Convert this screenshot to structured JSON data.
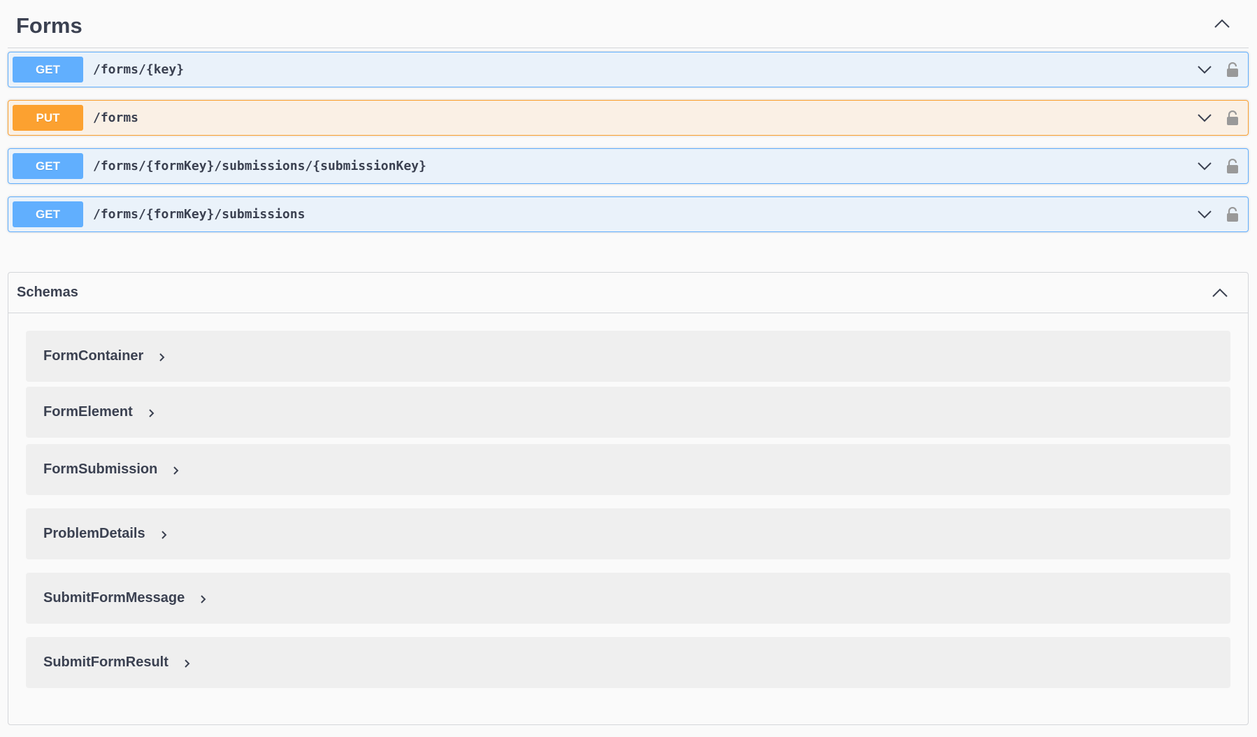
{
  "section": {
    "title": "Forms",
    "collapse_icon": "chevron-up-icon"
  },
  "operations": [
    {
      "method": "GET",
      "path": "/forms/{key}",
      "color": "#61affe"
    },
    {
      "method": "PUT",
      "path": "/forms",
      "color": "#fca130"
    },
    {
      "method": "GET",
      "path": "/forms/{formKey}/submissions/{submissionKey}",
      "color": "#61affe"
    },
    {
      "method": "GET",
      "path": "/forms/{formKey}/submissions",
      "color": "#61affe"
    }
  ],
  "schemas": {
    "title": "Schemas",
    "collapse_icon": "chevron-up-icon",
    "models": [
      {
        "name": "FormContainer"
      },
      {
        "name": "FormElement"
      },
      {
        "name": "FormSubmission"
      },
      {
        "name": "ProblemDetails"
      },
      {
        "name": "SubmitFormMessage"
      },
      {
        "name": "SubmitFormResult"
      }
    ]
  }
}
